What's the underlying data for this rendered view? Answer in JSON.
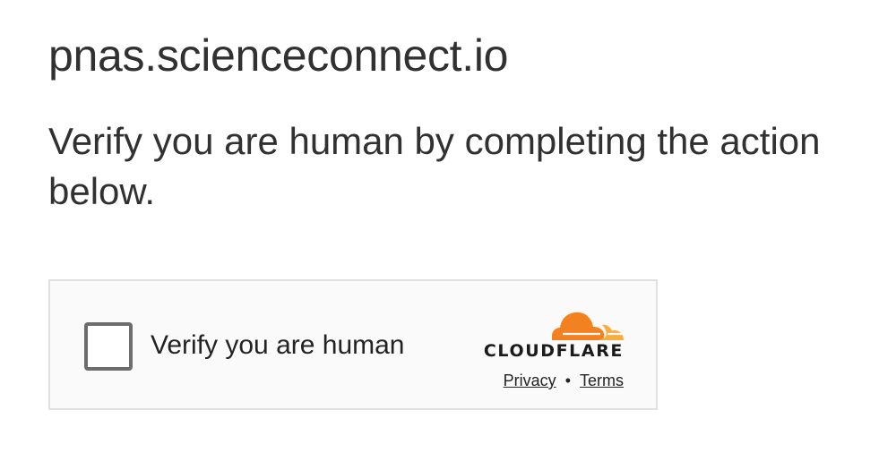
{
  "page": {
    "host": "pnas.scienceconnect.io",
    "instruction": "Verify you are human by completing the action below."
  },
  "challenge": {
    "checkbox_label": "Verify you are human",
    "checked": false,
    "brand": {
      "name": "CLOUDFLARE",
      "icon": "cloudflare-cloud-icon",
      "colors": {
        "primary_orange": "#f48120",
        "light_orange": "#faad3f"
      }
    },
    "links": {
      "privacy": "Privacy",
      "separator": "•",
      "terms": "Terms"
    }
  },
  "colors": {
    "text": "#313131",
    "widget_bg": "#fafafa",
    "widget_border": "#e0e0e0",
    "checkbox_border": "#6d6d6d"
  }
}
